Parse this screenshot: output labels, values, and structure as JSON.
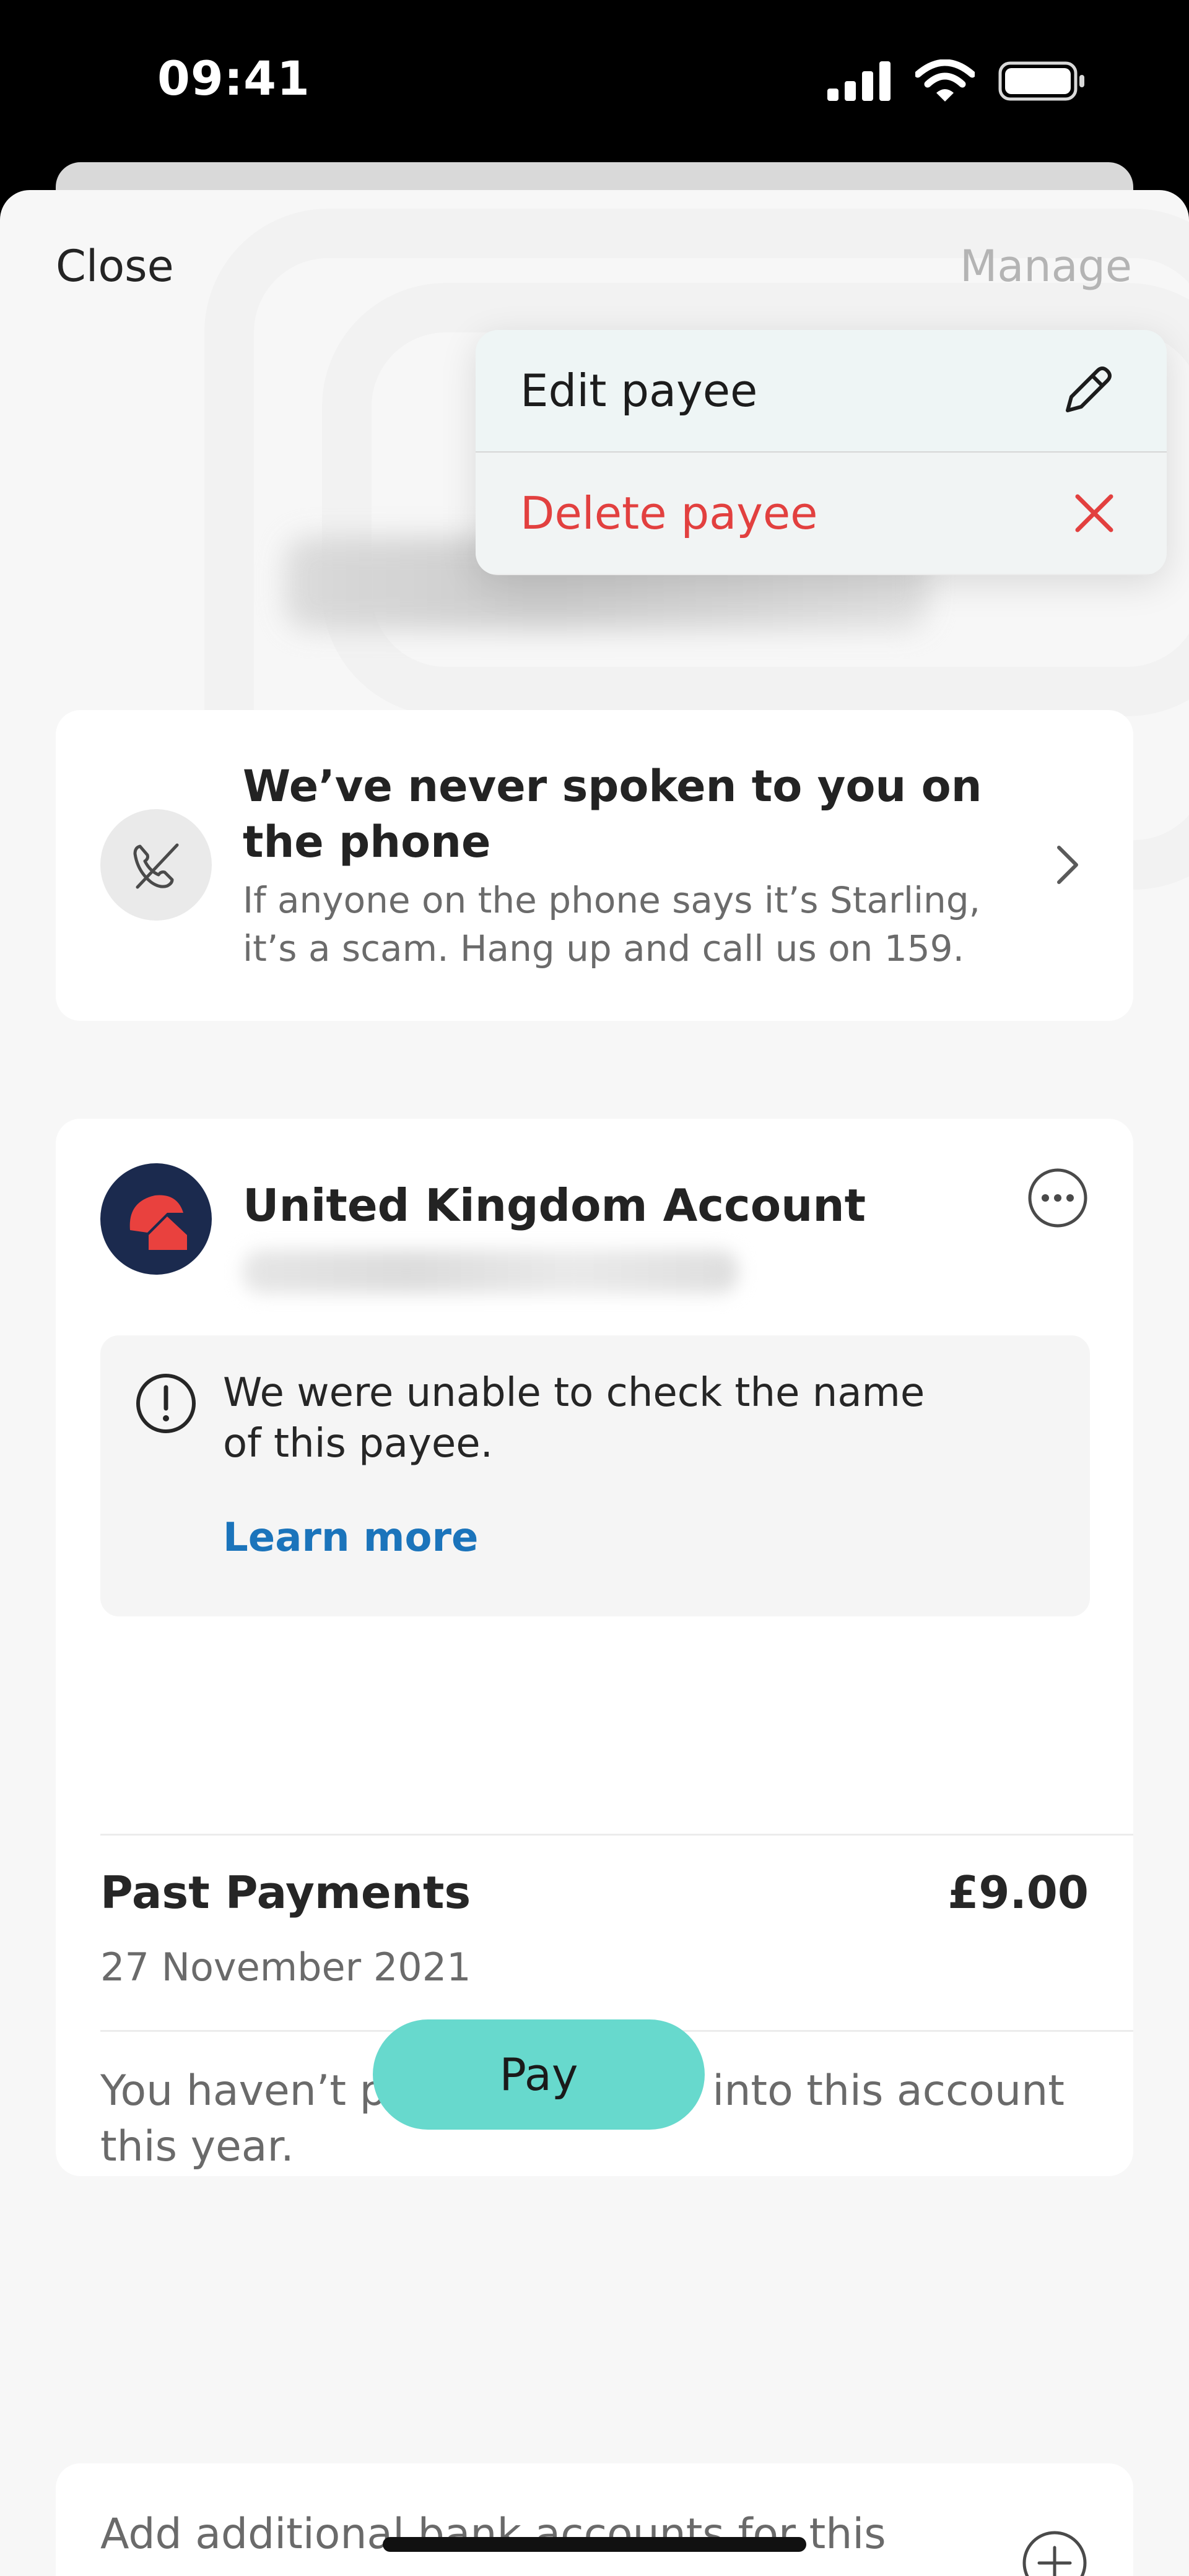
{
  "status_bar": {
    "time": "09:41",
    "icons": [
      "cellular-signal-icon",
      "wifi-icon",
      "battery-icon"
    ]
  },
  "nav": {
    "close_label": "Close",
    "manage_label": "Manage"
  },
  "manage_menu": {
    "edit_label": "Edit payee",
    "delete_label": "Delete payee",
    "delete_color": "#e2403f"
  },
  "scam_notice": {
    "title": "We’ve never spoken to you on the phone",
    "body": "If anyone on the phone says it’s Starling, it’s a scam. Hang up and call us on 159."
  },
  "account": {
    "title": "United Kingdom Account",
    "warning_text": "We were unable to check the name of this payee.",
    "learn_more_label": "Learn more",
    "learn_more_color": "#1b74bb",
    "past_payments_label": "Past Payments",
    "past_payments_amount": "£9.00",
    "past_payments_date": "27 November 2021",
    "no_payments_text": "You haven’t paid any money into this account this year.",
    "pay_label": "Pay",
    "pay_color": "#67d9cd"
  },
  "add_accounts": {
    "text": "Add additional bank accounts for this payee."
  }
}
